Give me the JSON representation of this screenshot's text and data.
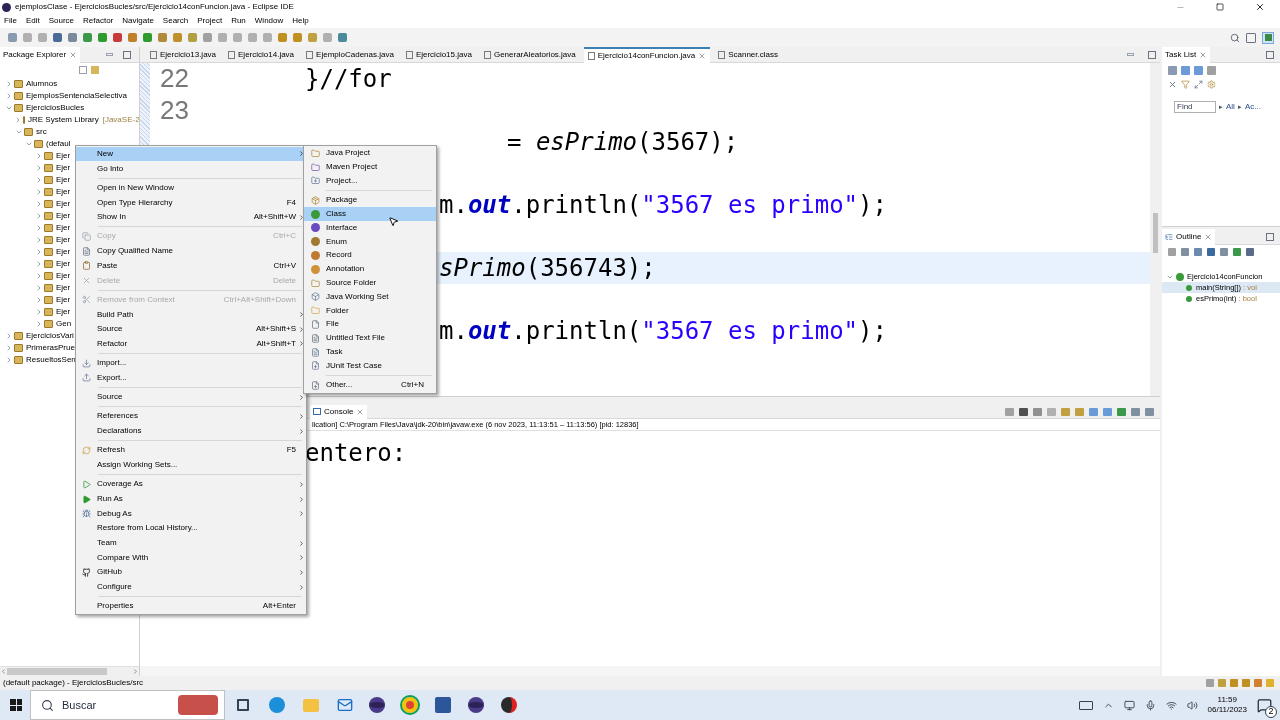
{
  "window": {
    "title": "ejemplosClase - EjerciciosBucles/src/Ejercicio14conFuncion.java - Eclipse IDE"
  },
  "menu_bar": [
    "File",
    "Edit",
    "Source",
    "Refactor",
    "Navigate",
    "Search",
    "Project",
    "Run",
    "Window",
    "Help"
  ],
  "package_explorer": {
    "title": "Package Explorer",
    "tree": [
      {
        "label": "Alumnos",
        "expanded": false
      },
      {
        "label": "EjemplosSentenciaSelectiva",
        "expanded": false
      },
      {
        "label": "EjerciciosBucles",
        "expanded": true,
        "children": [
          {
            "label": "JRE System Library",
            "decoration": "[JavaSE-2",
            "expanded": false
          },
          {
            "label": "src",
            "expanded": true,
            "children": [
              {
                "label": "(defaul",
                "expanded": true,
                "children": [
                  {
                    "label": "Ejer",
                    "expanded": false
                  },
                  {
                    "label": "Ejer",
                    "expanded": false
                  },
                  {
                    "label": "Ejer",
                    "expanded": false
                  },
                  {
                    "label": "Ejer",
                    "expanded": false
                  },
                  {
                    "label": "Ejer",
                    "expanded": false
                  },
                  {
                    "label": "Ejer",
                    "expanded": false
                  },
                  {
                    "label": "Ejer",
                    "expanded": false
                  },
                  {
                    "label": "Ejer",
                    "expanded": false
                  },
                  {
                    "label": "Ejer",
                    "expanded": false
                  },
                  {
                    "label": "Ejer",
                    "expanded": false
                  },
                  {
                    "label": "Ejer",
                    "expanded": false
                  },
                  {
                    "label": "Ejer",
                    "expanded": false
                  },
                  {
                    "label": "Ejer",
                    "expanded": false
                  },
                  {
                    "label": "Ejer",
                    "expanded": false
                  },
                  {
                    "label": "Gen",
                    "expanded": false
                  }
                ]
              }
            ]
          }
        ]
      },
      {
        "label": "EjerciciosVari",
        "expanded": false
      },
      {
        "label": "PrimerasPrue",
        "expanded": false
      },
      {
        "label": "ResueltosSen",
        "expanded": false
      }
    ]
  },
  "editor": {
    "tabs": [
      {
        "label": "Ejercicio13.java",
        "selected": false
      },
      {
        "label": "Ejercicio14.java",
        "selected": false
      },
      {
        "label": "EjemploCadenas.java",
        "selected": false
      },
      {
        "label": "Ejercicio15.java",
        "selected": false
      },
      {
        "label": "GenerarAleatorios.java",
        "selected": false
      },
      {
        "label": "Ejercicio14conFuncion.java",
        "selected": true
      },
      {
        "label": "Scanner.class",
        "selected": false
      }
    ],
    "lines": [
      {
        "number": "22",
        "kind": "full",
        "current": false,
        "tokens": [
          {
            "text": "}//for",
            "kind": "plain"
          }
        ]
      },
      {
        "number": "23",
        "kind": "blank",
        "current": false
      },
      {
        "kind": "tail",
        "current": false,
        "tokens": [
          {
            "text": "= ",
            "kind": "plain"
          },
          {
            "text": "esPrimo",
            "kind": "method"
          },
          {
            "text": "(3567);",
            "kind": "plain"
          }
        ]
      },
      {
        "kind": "blank",
        "current": false
      },
      {
        "kind": "fragment",
        "current": false,
        "tokens": [
          {
            "text": "m.",
            "kind": "plain"
          },
          {
            "text": "out",
            "kind": "field"
          },
          {
            "text": ".println(",
            "kind": "plain"
          },
          {
            "text": "\"3567 es primo\"",
            "kind": "string"
          },
          {
            "text": ");",
            "kind": "plain"
          }
        ]
      },
      {
        "kind": "blank",
        "current": false
      },
      {
        "kind": "fragment",
        "current": true,
        "tokens": [
          {
            "text": "sPrimo",
            "kind": "method"
          },
          {
            "text": "(356743);",
            "kind": "plain"
          }
        ]
      },
      {
        "kind": "blank",
        "current": false
      },
      {
        "kind": "fragment",
        "current": false,
        "tokens": [
          {
            "text": "m.",
            "kind": "plain"
          },
          {
            "text": "out",
            "kind": "field"
          },
          {
            "text": ".println(",
            "kind": "plain"
          },
          {
            "text": "\"3567 es primo\"",
            "kind": "string"
          },
          {
            "text": ");",
            "kind": "plain"
          }
        ]
      }
    ]
  },
  "console": {
    "tab": "Console",
    "header": "lication] C:\\Program Files\\Java\\jdk-20\\bin\\javaw.exe  (6 nov 2023, 11:13:51 – 11:13:56) [pid: 12836]",
    "output": "entero:"
  },
  "task_list": {
    "title": "Task List",
    "find_placeholder": "Find",
    "filters": [
      {
        "arrow": "▸",
        "label": "All"
      },
      {
        "arrow": "▸",
        "label": "Ac..."
      }
    ]
  },
  "outline": {
    "title": "Outline",
    "tree": [
      {
        "label": "Ejercicio14conFuncion",
        "selected": false,
        "expanded": true,
        "children": [
          {
            "label": "main(String[])",
            "type": " : voi",
            "selected": true
          },
          {
            "label": "esPrimo(int)",
            "type": " : bool",
            "selected": false
          }
        ]
      }
    ]
  },
  "context_menu": {
    "groups": [
      [
        {
          "label": "New",
          "submenu": true,
          "selected": true,
          "disabled": false
        },
        {
          "label": "Go Into",
          "submenu": false,
          "selected": false,
          "disabled": false
        }
      ],
      [
        {
          "label": "Open in New Window",
          "submenu": false,
          "selected": false,
          "disabled": false
        },
        {
          "label": "Open Type Hierarchy",
          "shortcut": "F4",
          "submenu": false,
          "selected": false,
          "disabled": false
        },
        {
          "label": "Show In",
          "shortcut": "Alt+Shift+W",
          "submenu": true,
          "selected": false,
          "disabled": false
        }
      ],
      [
        {
          "label": "Copy",
          "shortcut": "Ctrl+C",
          "submenu": false,
          "selected": false,
          "disabled": true
        },
        {
          "label": "Copy Qualified Name",
          "submenu": false,
          "selected": false,
          "disabled": false
        },
        {
          "label": "Paste",
          "shortcut": "Ctrl+V",
          "submenu": false,
          "selected": false,
          "disabled": false
        },
        {
          "label": "Delete",
          "shortcut": "Delete",
          "submenu": false,
          "selected": false,
          "disabled": true
        }
      ],
      [
        {
          "label": "Remove from Context",
          "shortcut": "Ctrl+Alt+Shift+Down",
          "submenu": false,
          "selected": false,
          "disabled": true
        },
        {
          "label": "Build Path",
          "submenu": true,
          "selected": false,
          "disabled": false
        },
        {
          "label": "Source",
          "shortcut": "Alt+Shift+S",
          "submenu": true,
          "selected": false,
          "disabled": false
        },
        {
          "label": "Refactor",
          "shortcut": "Alt+Shift+T",
          "submenu": true,
          "selected": false,
          "disabled": false
        }
      ],
      [
        {
          "label": "Import...",
          "submenu": false,
          "selected": false,
          "disabled": false
        },
        {
          "label": "Export...",
          "submenu": false,
          "selected": false,
          "disabled": false
        }
      ],
      [
        {
          "label": "Source",
          "submenu": true,
          "selected": false,
          "disabled": false
        }
      ],
      [
        {
          "label": "References",
          "submenu": true,
          "selected": false,
          "disabled": false
        },
        {
          "label": "Declarations",
          "submenu": true,
          "selected": false,
          "disabled": false
        }
      ],
      [
        {
          "label": "Refresh",
          "shortcut": "F5",
          "submenu": false,
          "selected": false,
          "disabled": false
        },
        {
          "label": "Assign Working Sets...",
          "submenu": false,
          "selected": false,
          "disabled": false
        }
      ],
      [
        {
          "label": "Coverage As",
          "submenu": true,
          "selected": false,
          "disabled": false
        },
        {
          "label": "Run As",
          "submenu": true,
          "selected": false,
          "disabled": false
        },
        {
          "label": "Debug As",
          "submenu": true,
          "selected": false,
          "disabled": false
        },
        {
          "label": "Restore from Local History...",
          "submenu": false,
          "selected": false,
          "disabled": false
        },
        {
          "label": "Team",
          "submenu": true,
          "selected": false,
          "disabled": false
        },
        {
          "label": "Compare With",
          "submenu": true,
          "selected": false,
          "disabled": false
        },
        {
          "label": "GitHub",
          "submenu": true,
          "selected": false,
          "disabled": false
        },
        {
          "label": "Configure",
          "submenu": true,
          "selected": false,
          "disabled": false
        }
      ],
      [
        {
          "label": "Properties",
          "shortcut": "Alt+Enter",
          "submenu": false,
          "selected": false,
          "disabled": false
        }
      ]
    ]
  },
  "new_submenu": {
    "groups": [
      [
        {
          "label": "Java Project",
          "selected": false
        },
        {
          "label": "Maven Project",
          "selected": false
        },
        {
          "label": "Project...",
          "selected": false
        }
      ],
      [
        {
          "label": "Package",
          "selected": false
        },
        {
          "label": "Class",
          "selected": true
        },
        {
          "label": "Interface",
          "selected": false
        },
        {
          "label": "Enum",
          "selected": false
        },
        {
          "label": "Record",
          "selected": false
        },
        {
          "label": "Annotation",
          "selected": false
        },
        {
          "label": "Source Folder",
          "selected": false
        },
        {
          "label": "Java Working Set",
          "selected": false
        },
        {
          "label": "Folder",
          "selected": false
        },
        {
          "label": "File",
          "selected": false
        },
        {
          "label": "Untitled Text File",
          "selected": false
        },
        {
          "label": "Task",
          "selected": false
        },
        {
          "label": "JUnit Test Case",
          "selected": false
        }
      ],
      [
        {
          "label": "Other...",
          "shortcut": "Ctrl+N",
          "selected": false
        }
      ]
    ]
  },
  "status_bar": "(default package) - EjerciciosBucles/src",
  "taskbar": {
    "search_placeholder": "Buscar",
    "time": "11:59",
    "date": "06/11/2023",
    "notifications": "2"
  }
}
